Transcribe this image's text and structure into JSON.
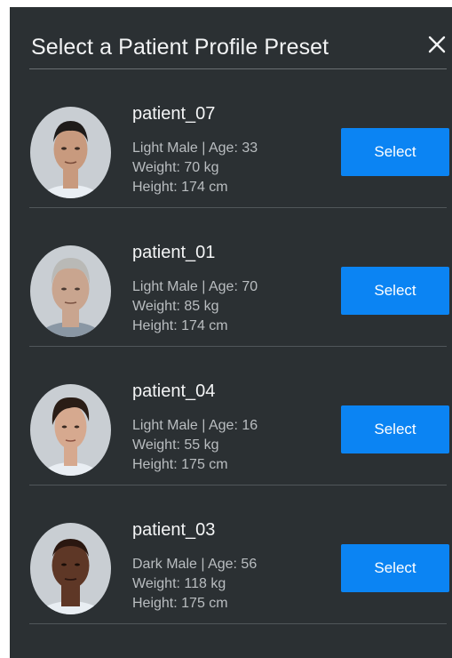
{
  "dialog": {
    "title": "Select a Patient Profile Preset",
    "close_icon": "close-icon"
  },
  "patients": [
    {
      "name": "patient_07",
      "description": "Light Male | Age: 33",
      "weight": "Weight: 70 kg",
      "height": "Height: 174 cm",
      "select_label": "Select",
      "skin_color": "#c89a7e",
      "hair_color": "#1e1b19"
    },
    {
      "name": "patient_01",
      "description": "Light Male | Age: 70",
      "weight": "Weight: 85 kg",
      "height": "Height: 174 cm",
      "select_label": "Select",
      "skin_color": "#c9a58f",
      "hair_color": "#b9b9b6"
    },
    {
      "name": "patient_04",
      "description": "Light Male | Age: 16",
      "weight": "Weight: 55 kg",
      "height": "Height: 175 cm",
      "select_label": "Select",
      "skin_color": "#d6a98f",
      "hair_color": "#2a1d16"
    },
    {
      "name": "patient_03",
      "description": "Dark Male | Age: 56",
      "weight": "Weight: 118 kg",
      "height": "Height: 175 cm",
      "select_label": "Select",
      "skin_color": "#5e3726",
      "hair_color": "#2a1710"
    }
  ],
  "colors": {
    "panel_background": "#2b3033",
    "button": "#0b84f3",
    "avatar_background": "#c9ced3"
  }
}
